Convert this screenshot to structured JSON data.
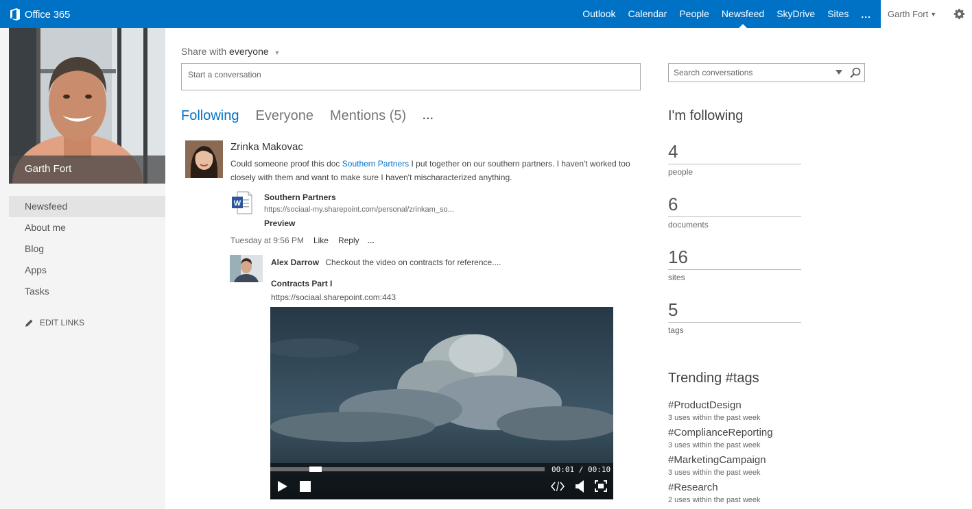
{
  "header": {
    "brand": "Office 365",
    "nav": [
      {
        "label": "Outlook"
      },
      {
        "label": "Calendar"
      },
      {
        "label": "People"
      },
      {
        "label": "Newsfeed",
        "active": true
      },
      {
        "label": "SkyDrive"
      },
      {
        "label": "Sites"
      }
    ],
    "more": "...",
    "user_name": "Garth Fort",
    "accent_color": "#0072c6"
  },
  "profile": {
    "name": "Garth Fort"
  },
  "sidebar": {
    "items": [
      {
        "label": "Newsfeed",
        "active": true
      },
      {
        "label": "About me"
      },
      {
        "label": "Blog"
      },
      {
        "label": "Apps"
      },
      {
        "label": "Tasks"
      }
    ],
    "edit_links": "EDIT LINKS"
  },
  "composer": {
    "share_prefix": "Share with",
    "share_target": "everyone",
    "placeholder": "Start a conversation"
  },
  "feed_tabs": {
    "items": [
      {
        "label": "Following",
        "active": true
      },
      {
        "label": "Everyone"
      },
      {
        "label": "Mentions (5)"
      }
    ],
    "more": "..."
  },
  "post": {
    "author": "Zrinka Makovac",
    "text_before": "Could someone proof this doc ",
    "link_text": "Southern Partners",
    "text_after": " I put together on our southern partners.  I haven't worked too closely with them and want to make sure I haven't mischaracterized anything.",
    "attachment": {
      "title": "Southern Partners",
      "url": "https://sociaal-my.sharepoint.com/personal/zrinkam_so...",
      "preview": "Preview"
    },
    "timestamp": "Tuesday at 9:56 PM",
    "like": "Like",
    "reply": "Reply",
    "more": "...",
    "reply_item": {
      "author": "Alex Darrow",
      "text": "Checkout the video on contracts for reference....",
      "video_title": "Contracts Part I",
      "video_url": "https://sociaal.sharepoint.com:443",
      "time_display": "00:01 / 00:10",
      "progress": 0.15
    }
  },
  "search": {
    "placeholder": "Search conversations"
  },
  "following": {
    "title": "I'm following",
    "stats": [
      {
        "value": "4",
        "label": "people"
      },
      {
        "value": "6",
        "label": "documents"
      },
      {
        "value": "16",
        "label": "sites"
      },
      {
        "value": "5",
        "label": "tags"
      }
    ]
  },
  "trending": {
    "title": "Trending #tags",
    "tags": [
      {
        "name": "#ProductDesign",
        "uses": "3 uses within the past week"
      },
      {
        "name": "#ComplianceReporting",
        "uses": "3 uses within the past week"
      },
      {
        "name": "#MarketingCampaign",
        "uses": "3 uses within the past week"
      },
      {
        "name": "#Research",
        "uses": "2 uses within the past week"
      }
    ]
  }
}
